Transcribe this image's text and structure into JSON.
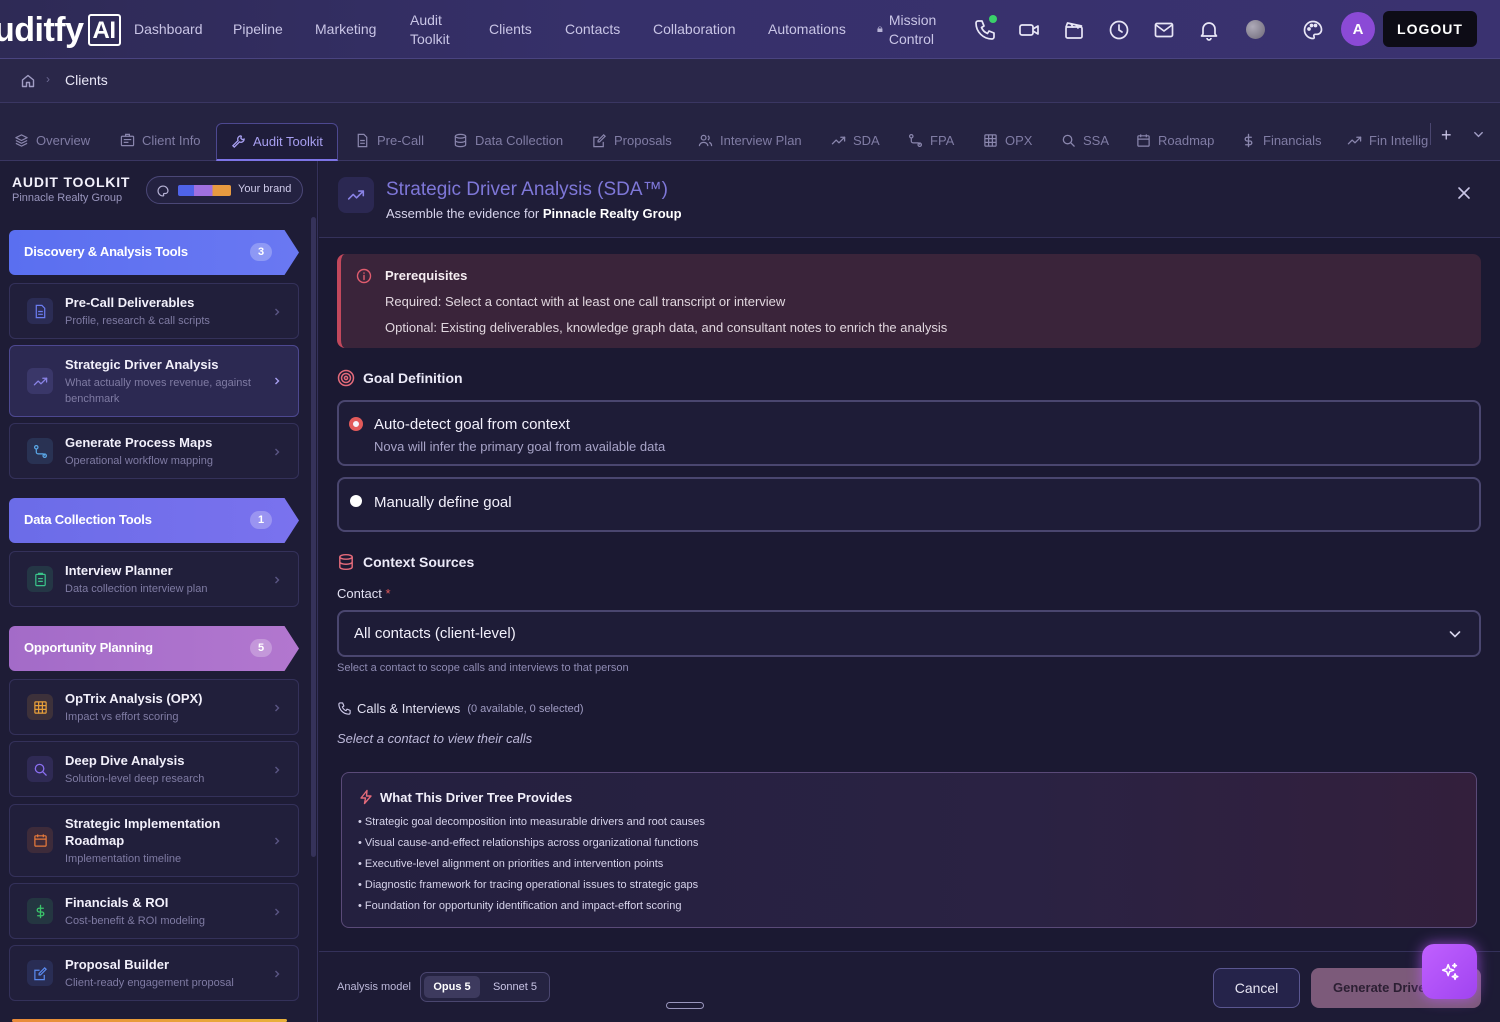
{
  "app": {
    "logo_text": "uditfy",
    "logo_ai": "AI",
    "nav": [
      {
        "label": "Dashboard"
      },
      {
        "label": "Pipeline"
      },
      {
        "label": "Marketing"
      },
      {
        "label": "Audit Toolkit"
      },
      {
        "label": "Clients"
      },
      {
        "label": "Contacts"
      },
      {
        "label": "Collaboration"
      },
      {
        "label": "Automations"
      },
      {
        "label": "Mission Control"
      }
    ],
    "nav_icons": [
      "phone-icon",
      "video-icon",
      "clapperboard-icon",
      "clock-icon",
      "mail-icon",
      "bell-icon",
      "theme-orb",
      "palette-icon"
    ],
    "avatar_initial": "A",
    "logout_label": "LOGOUT"
  },
  "breadcrumb": {
    "current": "Clients"
  },
  "tabs": [
    {
      "label": "Overview",
      "icon": "layers-icon"
    },
    {
      "label": "Client Info",
      "icon": "id-card-icon"
    },
    {
      "label": "Audit Toolkit",
      "icon": "wrench-icon",
      "active": true
    },
    {
      "label": "Pre-Call",
      "icon": "document-icon"
    },
    {
      "label": "Data Collection",
      "icon": "database-icon"
    },
    {
      "label": "Proposals",
      "icon": "edit-icon"
    },
    {
      "label": "Interview Plan",
      "icon": "users-icon"
    },
    {
      "label": "SDA",
      "icon": "trend-icon"
    },
    {
      "label": "FPA",
      "icon": "route-icon"
    },
    {
      "label": "OPX",
      "icon": "grid-icon"
    },
    {
      "label": "SSA",
      "icon": "search-icon"
    },
    {
      "label": "Roadmap",
      "icon": "calendar-icon"
    },
    {
      "label": "Financials",
      "icon": "dollar-icon"
    },
    {
      "label": "Fin Intellig",
      "icon": "trend-icon"
    }
  ],
  "sidebar": {
    "title": "AUDIT TOOLKIT",
    "subtitle": "Pinnacle Realty Group",
    "brand_label": "Your brand",
    "brand_colors": [
      "#4f63e8",
      "#a070e0",
      "#e89a40"
    ],
    "sections": [
      {
        "label": "Discovery & Analysis Tools",
        "count": "3",
        "color": "#5a6ff0"
      },
      {
        "label": "Data Collection Tools",
        "count": "1",
        "color": "#6b6ce8"
      },
      {
        "label": "Opportunity Planning",
        "count": "5",
        "color": "#a36bc8"
      }
    ],
    "tools": [
      {
        "name": "Pre-Call Deliverables",
        "desc": "Profile, research & call scripts",
        "icon": "document-icon",
        "color": "#6b7cf0"
      },
      {
        "name": "Strategic Driver Analysis",
        "desc": "What actually moves revenue, against benchmark",
        "icon": "trend-icon",
        "color": "#8a83e6",
        "selected": true
      },
      {
        "name": "Generate Process Maps",
        "desc": "Operational workflow mapping",
        "icon": "route-icon",
        "color": "#5aa8e8"
      },
      {
        "name": "Interview Planner",
        "desc": "Data collection interview plan",
        "icon": "clipboard-icon",
        "color": "#3ac48a"
      },
      {
        "name": "OpTrix Analysis (OPX)",
        "desc": "Impact vs effort scoring",
        "icon": "grid-icon",
        "color": "#e8a03a"
      },
      {
        "name": "Deep Dive Analysis",
        "desc": "Solution-level deep research",
        "icon": "search-icon",
        "color": "#8a6ef0"
      },
      {
        "name": "Strategic Implementation Roadmap",
        "desc": "Implementation timeline",
        "icon": "calendar-icon",
        "color": "#e87a3a"
      },
      {
        "name": "Financials & ROI",
        "desc": "Cost-benefit & ROI modeling",
        "icon": "dollar-icon",
        "color": "#3ac46a"
      },
      {
        "name": "Proposal Builder",
        "desc": "Client-ready engagement proposal",
        "icon": "edit-icon",
        "color": "#5a8af0"
      }
    ]
  },
  "panel": {
    "title": "Strategic Driver Analysis (SDA™)",
    "subtitle_prefix": "Assemble the evidence for ",
    "subtitle_client": "Pinnacle Realty Group",
    "prereq": {
      "title": "Prerequisites",
      "required": "Required: Select a contact with at least one call transcript or interview",
      "optional": "Optional: Existing deliverables, knowledge graph data, and consultant notes to enrich the analysis"
    },
    "goal_section": "Goal Definition",
    "goal_options": [
      {
        "title": "Auto-detect goal from context",
        "desc": "Nova will infer the primary goal from available data",
        "selected": true
      },
      {
        "title": "Manually define goal",
        "desc": "",
        "selected": false
      }
    ],
    "context_section": "Context Sources",
    "contact_label": "Contact",
    "contact_required_mark": "*",
    "contact_value": "All contacts (client-level)",
    "contact_help": "Select a contact to scope calls and interviews to that person",
    "calls_label": "Calls & Interviews",
    "calls_meta": "(0 available, 0 selected)",
    "calls_empty": "Select a contact to view their calls",
    "provides_title": "What This Driver Tree Provides",
    "provides_items": [
      "• Strategic goal decomposition into measurable drivers and root causes",
      "• Visual cause-and-effect relationships across organizational functions",
      "• Executive-level alignment on priorities and intervention points",
      "• Diagnostic framework for tracing operational issues to strategic gaps",
      "• Foundation for opportunity identification and impact-effort scoring"
    ]
  },
  "footer": {
    "model_label": "Analysis model",
    "models": [
      {
        "label": "Opus 5",
        "selected": true
      },
      {
        "label": "Sonnet 5",
        "selected": false
      }
    ],
    "cancel_label": "Cancel",
    "generate_label": "Generate Driver Tree"
  },
  "colors": {
    "accent": "#7d74e6",
    "danger": "#e25a5a",
    "nav_bg": "#2e2a55",
    "fab": "#c060ff"
  }
}
